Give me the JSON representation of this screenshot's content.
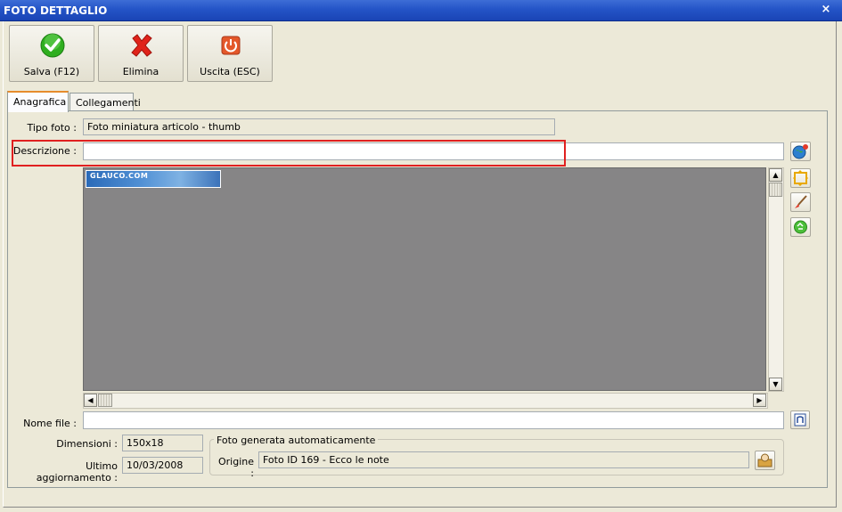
{
  "window": {
    "title": "FOTO DETTAGLIO",
    "close_glyph": "×"
  },
  "toolbar": {
    "save_label": "Salva (F12)",
    "delete_label": "Elimina",
    "exit_label": "Uscita (ESC)"
  },
  "tabs": [
    {
      "label": "Anagrafica",
      "active": true
    },
    {
      "label": "Collegamenti",
      "active": false
    }
  ],
  "form": {
    "tipo_foto_label": "Tipo foto :",
    "tipo_foto_value": "Foto miniatura articolo - thumb",
    "descrizione_label": "Descrizione :",
    "descrizione_value": "",
    "nome_file_label": "Nome file :",
    "nome_file_value": "",
    "dimensioni_label": "Dimensioni :",
    "dimensioni_value": "150x18",
    "ultimo_agg_label": "Ultimo aggiornamento :",
    "ultimo_agg_value": "10/03/2008"
  },
  "auto_group": {
    "title": "Foto generata automaticamente",
    "origine_label": "Origine :",
    "origine_value": "Foto ID 169 - Ecco le note"
  },
  "image_preview": {
    "banner_text": "GLAUCO.COM"
  },
  "icons": {
    "save": "check-icon",
    "delete": "x-icon",
    "exit": "power-icon",
    "side": [
      "globe-icon",
      "resize-icon",
      "brush-icon",
      "recycle-icon"
    ],
    "file": "browse-icon",
    "origin": "lookup-icon"
  },
  "colors": {
    "title_bar": "#2454c7",
    "highlight_box": "#e02020",
    "save_green": "#2fae1f",
    "delete_red": "#e0231a",
    "exit_orange": "#e4582a"
  }
}
